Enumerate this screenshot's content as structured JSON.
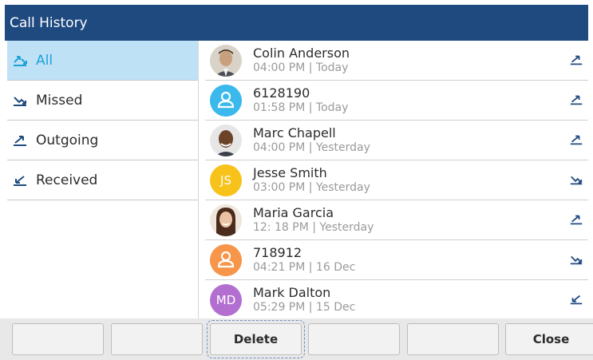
{
  "title": "Call History",
  "sidebar": {
    "items": [
      {
        "label": "All",
        "icon": "all-calls-icon",
        "active": true
      },
      {
        "label": "Missed",
        "icon": "missed-call-icon",
        "active": false
      },
      {
        "label": "Outgoing",
        "icon": "outgoing-call-icon",
        "active": false
      },
      {
        "label": "Received",
        "icon": "received-call-icon",
        "active": false
      }
    ]
  },
  "calls": [
    {
      "name": "Colin Anderson",
      "meta": "04:00 PM | Today",
      "avatar": "photo",
      "direction": "outgoing"
    },
    {
      "name": "6128190",
      "meta": "01:58 PM | Today",
      "avatar": "generic",
      "avatar_color": "#3bb9ec",
      "direction": "outgoing"
    },
    {
      "name": "Marc Chapell",
      "meta": "04:00 PM | Yesterday",
      "avatar": "photo",
      "direction": "outgoing"
    },
    {
      "name": "Jesse Smith",
      "meta": "03:00 PM | Yesterday",
      "avatar": "initials",
      "initials": "JS",
      "avatar_color": "#f7c21a",
      "direction": "missed"
    },
    {
      "name": "Maria Garcia",
      "meta": "12: 18 PM | Yesterday",
      "avatar": "photo",
      "direction": "outgoing"
    },
    {
      "name": "718912",
      "meta": "04:21 PM | 16 Dec",
      "avatar": "generic",
      "avatar_color": "#f7954a",
      "direction": "missed"
    },
    {
      "name": "Mark Dalton",
      "meta": "05:29 PM | 15 Dec",
      "avatar": "initials",
      "initials": "MD",
      "avatar_color": "#b36fd0",
      "direction": "received"
    }
  ],
  "softkeys": [
    "",
    "",
    "Delete",
    "",
    "",
    "Close"
  ],
  "colors": {
    "titlebar": "#1f4a80",
    "active_bg": "#bfe1f6",
    "active_text": "#1aa3d9",
    "icon_blue": "#1f4a80"
  }
}
